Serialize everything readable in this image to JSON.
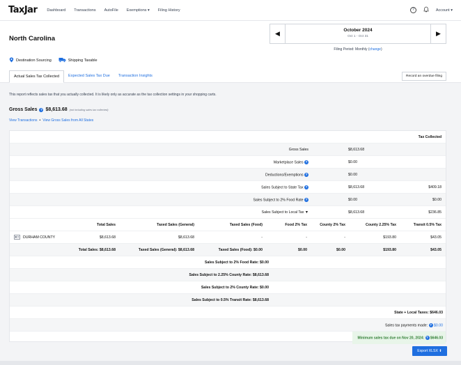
{
  "nav": {
    "logo": "TaxJar",
    "items": [
      "Dashboard",
      "Transactions",
      "AutoFile",
      "Exemptions ▾",
      "Filing History"
    ],
    "help": "?",
    "bell": "🔔",
    "account": "Account ▾"
  },
  "header": {
    "state": "North Carolina",
    "period_month": "October 2024",
    "period_range": "Oct 1 - Oct 31",
    "prev": "◀",
    "next": "▶",
    "filing_label": "Filing Period: Monthly (",
    "filing_change": "change",
    "filing_close": ")",
    "tag1": "Destination Sourcing",
    "tag2": "Shipping Taxable"
  },
  "tabs": [
    "Actual Sales Tax Collected",
    "Expected Sales Tax Due",
    "Transaction Insights"
  ],
  "overdue_button": "Record an overdue filing",
  "intro": "This report reflects sales tax that you actually collected. It is likely only as accurate as the tax collection settings in your shopping carts.",
  "gross": {
    "label": "Gross Sales",
    "value": "$8,613.68",
    "note": "(not including sales tax collected)",
    "link1": "View Transactions",
    "dot": "•",
    "link2": "View Gross Sales from All States"
  },
  "summary": {
    "tax_collected_header": "Tax Collected",
    "rows": [
      {
        "label": "Gross Sales",
        "amount": "$8,613.68",
        "tax": ""
      },
      {
        "label": "Marketplace Sales",
        "amount": "$0.00",
        "tax": ""
      },
      {
        "label": "Deductions/Exemptions",
        "amount": "$0.00",
        "tax": ""
      },
      {
        "label": "Sales Subject to State Tax",
        "amount": "$8,613.68",
        "tax": "$409.18"
      },
      {
        "label": "Sales Subject to 2% Food Rate",
        "amount": "$0.00",
        "tax": "$0.00"
      },
      {
        "label": "Sales Subject to Local Tax",
        "amount": "$8,613.68",
        "tax": "$236.85"
      }
    ]
  },
  "local": {
    "headers": [
      "Total Sales",
      "Taxed Sales (General)",
      "Taxed Sales (Food)",
      "Food 2% Tax",
      "County 2% Tax",
      "County 2.25% Tax",
      "Transit 0.5% Tax"
    ],
    "county": {
      "name": "DURHAM COUNTY",
      "values": [
        "$8,613.68",
        "$8,613.68",
        "-",
        "-",
        "-",
        "$193.80",
        "$43.05"
      ]
    },
    "totals": {
      "total_sales": "Total Sales: $8,613.68",
      "taxed_general": "Taxed Sales (General): $8,613.68",
      "taxed_food": "Taxed Sales (Food): $0.00",
      "food_tax": "$0.00",
      "county2": "$0.00",
      "county225": "$193.80",
      "transit": "$43.05"
    },
    "subjects": [
      "Sales Subject to 2% Food Rate: $0.00",
      "Sales Subject to 2.25% County Rate: $8,613.68",
      "Sales Subject to 2% County Rate: $0.00",
      "Sales Subject to 0.5% Transit Rate: $8,613.68"
    ]
  },
  "footer": {
    "state_local": "State + Local Taxes: $646.03",
    "payments_label": "Sales tax payments made:",
    "payments_value": "$0.00",
    "minimum_label": "Minimum sales tax due on Nov 20, 2024:",
    "minimum_value": "$646.03",
    "export": "Export XLSX ⬆"
  }
}
